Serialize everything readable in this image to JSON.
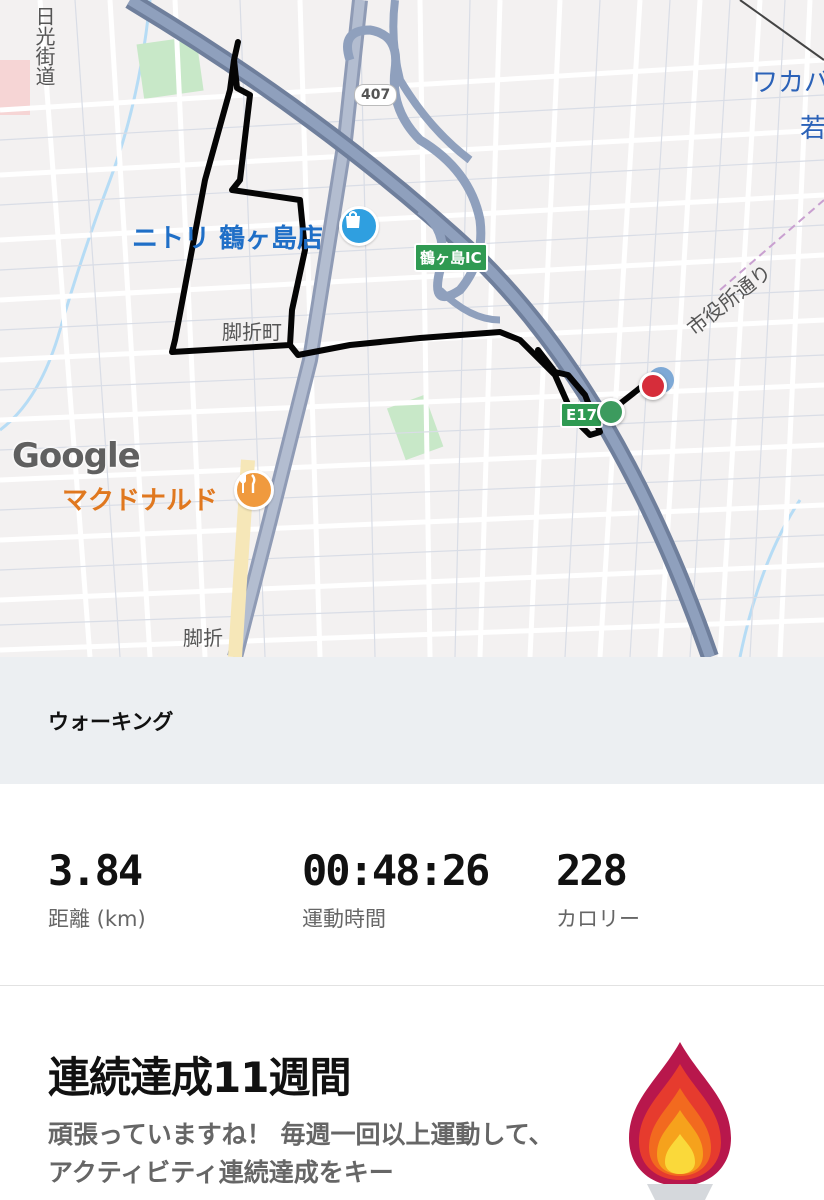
{
  "map": {
    "labels": {
      "nitori": "ニトリ 鶴ヶ島店",
      "mcdonalds": "マクドナルド",
      "ashiori_cho": "脚折町",
      "ashiori": "脚折",
      "shiyakusho_dori": "市役所通り",
      "nikko_kaido": "日光街道",
      "wakaba": "ワカバ",
      "waka": "若"
    },
    "shields": {
      "route_407": "407",
      "interchange": "鶴ヶ島IC",
      "expressway": "E17"
    },
    "attribution": "Google",
    "icons": {
      "shopping": "shopping-bag-icon",
      "restaurant": "fork-knife-icon"
    },
    "colors": {
      "route_line": "#000000",
      "start_marker": "#3c9b5e",
      "end_marker": "#d62d3a",
      "expressway": "#7a8aa6"
    }
  },
  "activity": {
    "type": "ウォーキング"
  },
  "stats": {
    "distance": {
      "value": "3.84",
      "label": "距離 (km)"
    },
    "duration": {
      "value": "00:48:26",
      "label": "運動時間"
    },
    "calories": {
      "value": "228",
      "label": "カロリー"
    }
  },
  "streak": {
    "title": "連続達成11週間",
    "description": "頑張っていますね！ 毎週一回以上運動して、アクティビティ連続達成をキー",
    "icon": "flame-icon"
  }
}
